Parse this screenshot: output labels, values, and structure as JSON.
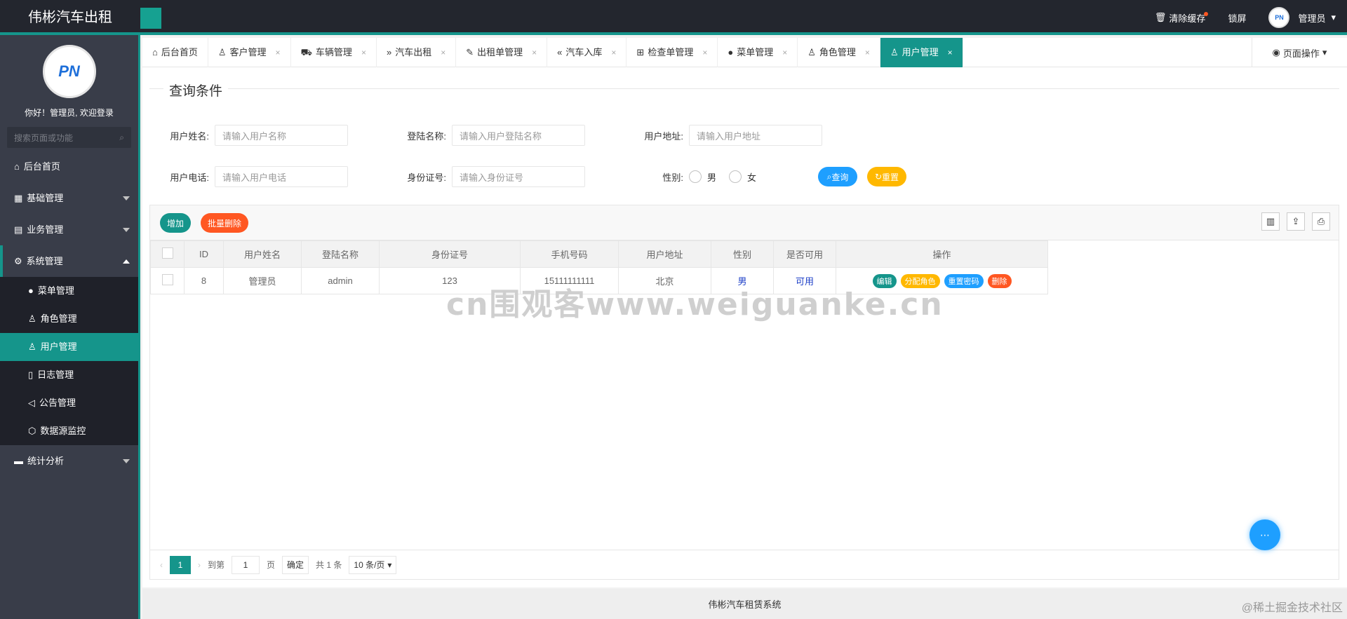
{
  "header": {
    "brand": "伟彬汽车出租",
    "clear_cache": "清除缓存",
    "lock_screen": "锁屏",
    "user_name": "管理员",
    "avatar_text": "PN"
  },
  "sidebar": {
    "logo_text": "PN",
    "welcome": "你好！管理员, 欢迎登录",
    "search_placeholder": "搜索页面或功能",
    "items": [
      {
        "label": "后台首页"
      },
      {
        "label": "基础管理"
      },
      {
        "label": "业务管理"
      },
      {
        "label": "系统管理"
      },
      {
        "label": "统计分析"
      }
    ],
    "sub_items": [
      {
        "label": "菜单管理"
      },
      {
        "label": "角色管理"
      },
      {
        "label": "用户管理"
      },
      {
        "label": "日志管理"
      },
      {
        "label": "公告管理"
      },
      {
        "label": "数据源监控"
      }
    ]
  },
  "tabs": [
    {
      "label": "后台首页"
    },
    {
      "label": "客户管理"
    },
    {
      "label": "车辆管理"
    },
    {
      "label": "汽车出租"
    },
    {
      "label": "出租单管理"
    },
    {
      "label": "汽车入库"
    },
    {
      "label": "检查单管理"
    },
    {
      "label": "菜单管理"
    },
    {
      "label": "角色管理"
    },
    {
      "label": "用户管理"
    }
  ],
  "tab_close": "×",
  "page_ops": "页面操作",
  "query": {
    "title": "查询条件",
    "user_name_label": "用户姓名:",
    "user_name_placeholder": "请输入用户名称",
    "login_name_label": "登陆名称:",
    "login_name_placeholder": "请输入用户登陆名称",
    "address_label": "用户地址:",
    "address_placeholder": "请输入用户地址",
    "phone_label": "用户电话:",
    "phone_placeholder": "请输入用户电话",
    "idcard_label": "身份证号:",
    "idcard_placeholder": "请输入身份证号",
    "gender_label": "性别:",
    "male": "男",
    "female": "女",
    "search_btn": "查询",
    "reset_btn": "重置"
  },
  "toolbar": {
    "add_btn": "增加",
    "batch_delete_btn": "批量删除"
  },
  "table": {
    "headers": [
      "ID",
      "用户姓名",
      "登陆名称",
      "身份证号",
      "手机号码",
      "用户地址",
      "性别",
      "是否可用",
      "操作"
    ],
    "rows": [
      {
        "id": "8",
        "name": "管理员",
        "login": "admin",
        "idcard": "123",
        "phone": "15111111111",
        "address": "北京",
        "gender": "男",
        "available": "可用"
      }
    ],
    "actions": {
      "edit": "编辑",
      "assign_role": "分配角色",
      "reset_pwd": "重置密码",
      "delete": "删除"
    }
  },
  "pager": {
    "current": "1",
    "goto": "到第",
    "page_input": "1",
    "page_unit": "页",
    "confirm": "确定",
    "total": "共 1 条",
    "page_size": "10 条/页"
  },
  "watermark": "cn围观客www.weiguanke.cn",
  "footer": "伟彬汽车租赁系统",
  "corner_mark": "@稀土掘金技术社区"
}
